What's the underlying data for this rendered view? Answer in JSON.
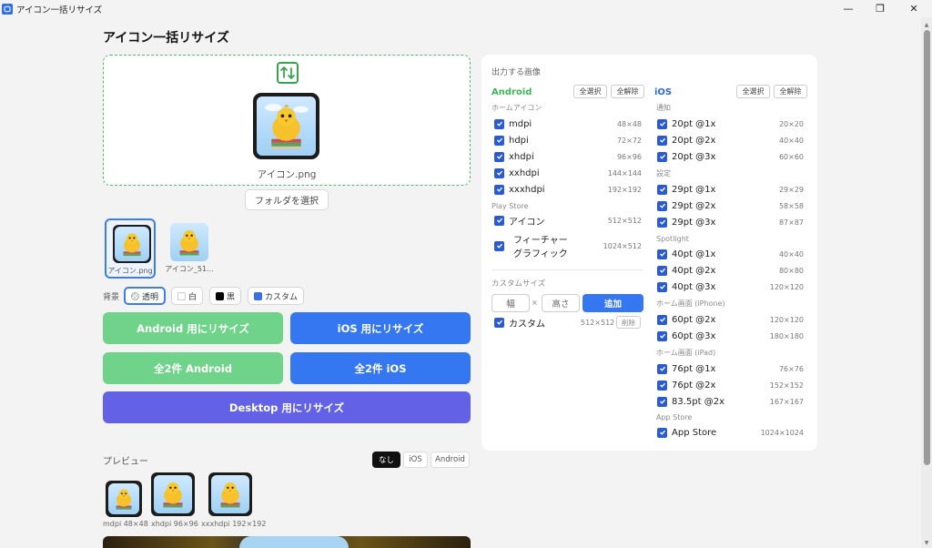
{
  "window": {
    "title": "アイコン一括リサイズ",
    "minimize": "—",
    "maximize": "❐",
    "close": "✕"
  },
  "page": {
    "title": "アイコン一括リサイズ"
  },
  "dropzone": {
    "file_name": "アイコン.png"
  },
  "folder_button": "フォルダを選択",
  "thumbnails": [
    {
      "label": "アイコン.png",
      "selected": true
    },
    {
      "label": "アイコン_51...",
      "selected": false
    }
  ],
  "background": {
    "label": "背景",
    "options": [
      {
        "label": "透明",
        "selected": true,
        "color": "#cccccc"
      },
      {
        "label": "白",
        "selected": false,
        "color": "#ffffff"
      },
      {
        "label": "黒",
        "selected": false,
        "color": "#000000"
      },
      {
        "label": "カスタム",
        "selected": false,
        "color": "#3b6fe8"
      }
    ]
  },
  "actions": {
    "android": "Android 用にリサイズ",
    "ios": "iOS 用にリサイズ",
    "all_android": "全2件 Android",
    "all_ios": "全2件 iOS",
    "desktop": "Desktop 用にリサイズ"
  },
  "colors": {
    "green": "#6fd389",
    "blue": "#3577f1",
    "purple": "#6362e6",
    "android_green": "#3cb556",
    "ios_blue": "#2d68d8"
  },
  "preview": {
    "label": "プレビュー",
    "tabs": [
      "なし",
      "iOS",
      "Android"
    ],
    "active_tab": "なし",
    "items": [
      {
        "label": "mdpi 48×48"
      },
      {
        "label": "xhdpi 96×96"
      },
      {
        "label": "xxxhdpi 192×192"
      }
    ]
  },
  "output": {
    "title": "出力する画像",
    "select_all": "全選択",
    "deselect_all": "全解除",
    "android": {
      "title": "Android",
      "home_label": "ホームアイコン",
      "home": [
        {
          "label": "mdpi",
          "size": "48×48"
        },
        {
          "label": "hdpi",
          "size": "72×72"
        },
        {
          "label": "xhdpi",
          "size": "96×96"
        },
        {
          "label": "xxhdpi",
          "size": "144×144"
        },
        {
          "label": "xxxhdpi",
          "size": "192×192"
        }
      ],
      "play_label": "Play Store",
      "play": [
        {
          "label": "アイコン",
          "size": "512×512"
        },
        {
          "label": "フィーチャー",
          "label2": "グラフィック",
          "size": "1024×512"
        }
      ]
    },
    "custom": {
      "title": "カスタムサイズ",
      "width_placeholder": "幅",
      "times": "×",
      "height_placeholder": "高さ",
      "add": "追加",
      "item": {
        "label": "カスタム",
        "size": "512×512",
        "delete": "削除"
      }
    },
    "ios": {
      "title": "iOS",
      "groups": [
        {
          "label": "通知",
          "items": [
            {
              "label": "20pt @1x",
              "size": "20×20"
            },
            {
              "label": "20pt @2x",
              "size": "40×40"
            },
            {
              "label": "20pt @3x",
              "size": "60×60"
            }
          ]
        },
        {
          "label": "設定",
          "items": [
            {
              "label": "29pt @1x",
              "size": "29×29"
            },
            {
              "label": "29pt @2x",
              "size": "58×58"
            },
            {
              "label": "29pt @3x",
              "size": "87×87"
            }
          ]
        },
        {
          "label": "Spotlight",
          "items": [
            {
              "label": "40pt @1x",
              "size": "40×40"
            },
            {
              "label": "40pt @2x",
              "size": "80×80"
            },
            {
              "label": "40pt @3x",
              "size": "120×120"
            }
          ]
        },
        {
          "label": "ホーム画面 (iPhone)",
          "items": [
            {
              "label": "60pt @2x",
              "size": "120×120"
            },
            {
              "label": "60pt @3x",
              "size": "180×180"
            }
          ]
        },
        {
          "label": "ホーム画面 (iPad)",
          "items": [
            {
              "label": "76pt @1x",
              "size": "76×76"
            },
            {
              "label": "76pt @2x",
              "size": "152×152"
            },
            {
              "label": "83.5pt @2x",
              "size": "167×167"
            }
          ]
        },
        {
          "label": "App Store",
          "items": [
            {
              "label": "App Store",
              "size": "1024×1024"
            }
          ]
        }
      ]
    }
  }
}
